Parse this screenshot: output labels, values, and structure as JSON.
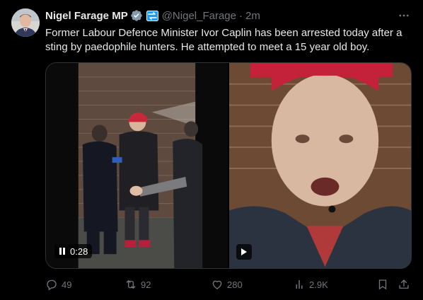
{
  "tweet": {
    "display_name": "Nigel Farage MP",
    "handle": "@Nigel_Farage",
    "separator": "·",
    "time": "2m",
    "text": "Former Labour Defence Minister Ivor Caplin has been arrested today after a sting by paedophile hunters. He attempted to meet a 15 year old boy.",
    "icons": {
      "verified": "verified-badge-icon",
      "affiliate": "affiliate-badge-icon",
      "more": "more-icon"
    }
  },
  "media": {
    "video_left": {
      "duration": "0:28",
      "state": "paused"
    },
    "video_right": {
      "state": "play"
    }
  },
  "actions": {
    "reply_count": "49",
    "retweet_count": "92",
    "like_count": "280",
    "views_count": "2.9K"
  },
  "colors": {
    "background": "#000000",
    "text": "#e7e9ea",
    "secondary": "#71767b",
    "verified": "#829aab",
    "affiliate": "#1d9bf0"
  }
}
